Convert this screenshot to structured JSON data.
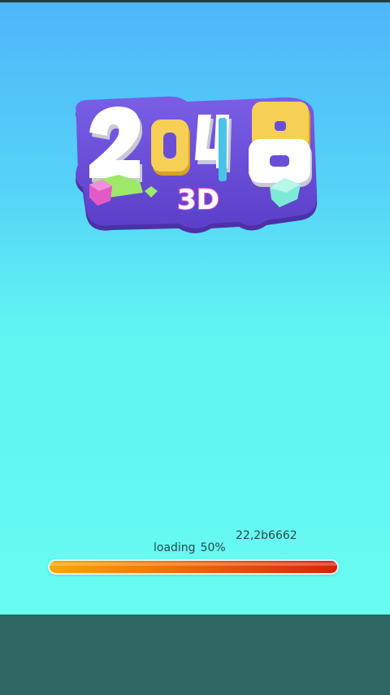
{
  "game": {
    "logo": {
      "digits": [
        "2",
        "0",
        "4",
        "8"
      ],
      "subtitle": "3D"
    },
    "version": "22,2b6662",
    "loading": {
      "label": "loading",
      "percent_text": "50%",
      "progress": 0.5
    }
  },
  "colors": {
    "sky_top": "#4eb6fb",
    "sky_bottom": "#67fbf1",
    "bottom_bar": "#2e6663",
    "logo_plate": "#6a4fd6",
    "progress_start": "#f6a700",
    "progress_end": "#d62310"
  }
}
